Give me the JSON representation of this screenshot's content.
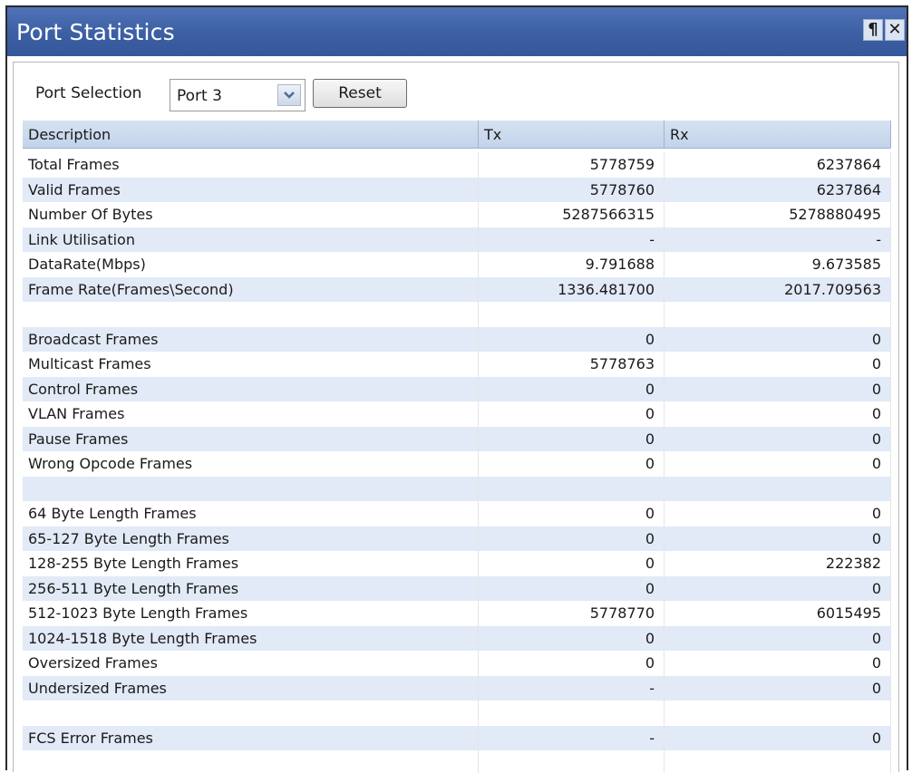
{
  "window": {
    "title": "Port Statistics",
    "pin_glyph": "¶",
    "close_glyph": "✕"
  },
  "toolbar": {
    "port_selection_label": "Port Selection",
    "port_selected": "Port 3",
    "reset_label": "Reset"
  },
  "table": {
    "headers": {
      "description": "Description",
      "tx": "Tx",
      "rx": "Rx"
    },
    "rows": [
      {
        "description": "Total Frames",
        "tx": "5778759",
        "rx": "6237864"
      },
      {
        "description": "Valid Frames",
        "tx": "5778760",
        "rx": "6237864"
      },
      {
        "description": "Number Of Bytes",
        "tx": "5287566315",
        "rx": "5278880495"
      },
      {
        "description": "Link Utilisation",
        "tx": "-",
        "rx": "-"
      },
      {
        "description": "DataRate(Mbps)",
        "tx": "9.791688",
        "rx": "9.673585"
      },
      {
        "description": "Frame Rate(Frames\\Second)",
        "tx": "1336.481700",
        "rx": "2017.709563"
      },
      {
        "description": "",
        "tx": "",
        "rx": ""
      },
      {
        "description": "Broadcast Frames",
        "tx": "0",
        "rx": "0"
      },
      {
        "description": "Multicast Frames",
        "tx": "5778763",
        "rx": "0"
      },
      {
        "description": "Control Frames",
        "tx": "0",
        "rx": "0"
      },
      {
        "description": "VLAN Frames",
        "tx": "0",
        "rx": "0"
      },
      {
        "description": "Pause Frames",
        "tx": "0",
        "rx": "0"
      },
      {
        "description": "Wrong Opcode Frames",
        "tx": "0",
        "rx": "0"
      },
      {
        "description": "",
        "tx": "",
        "rx": ""
      },
      {
        "description": "64 Byte Length Frames",
        "tx": "0",
        "rx": "0"
      },
      {
        "description": "65-127 Byte Length Frames",
        "tx": "0",
        "rx": "0"
      },
      {
        "description": "128-255 Byte Length Frames",
        "tx": "0",
        "rx": "222382"
      },
      {
        "description": "256-511 Byte Length Frames",
        "tx": "0",
        "rx": "0"
      },
      {
        "description": "512-1023 Byte Length Frames",
        "tx": "5778770",
        "rx": "6015495"
      },
      {
        "description": "1024-1518 Byte Length Frames",
        "tx": "0",
        "rx": "0"
      },
      {
        "description": "Oversized Frames",
        "tx": "0",
        "rx": "0"
      },
      {
        "description": "Undersized Frames",
        "tx": "-",
        "rx": "0"
      },
      {
        "description": "",
        "tx": "",
        "rx": ""
      },
      {
        "description": "FCS Error Frames",
        "tx": "-",
        "rx": "0"
      },
      {
        "description": "",
        "tx": "",
        "rx": ""
      }
    ]
  },
  "colors": {
    "titlebar": "#3c5fa4",
    "header": "#c8d7ec",
    "alt_row": "#e1eaf6"
  },
  "icons": {
    "pin": "pin-icon",
    "close": "close-icon",
    "dropdown": "chevron-down-icon"
  }
}
